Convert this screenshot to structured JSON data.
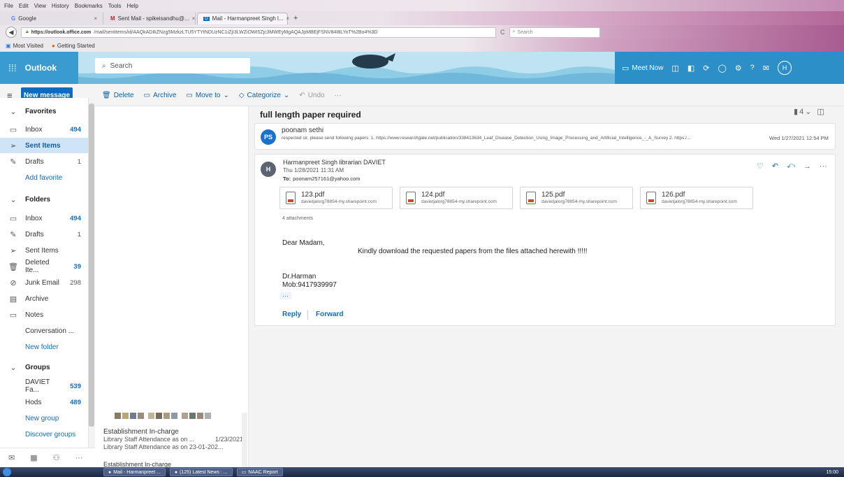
{
  "browser": {
    "menu": [
      "File",
      "Edit",
      "View",
      "History",
      "Bookmarks",
      "Tools",
      "Help"
    ],
    "tabs": [
      {
        "label": "Google"
      },
      {
        "label": "Sent Mail - spikeisandhu@..."
      },
      {
        "label": "Mail - Harmanpreet Singh l..."
      }
    ],
    "url_host": "https://outlook.office.com",
    "url_path": "/mail/sentitems/id/AAQkADIkZNzg5MzkzLTU5YTYtNDUzNC1iZjI3LWZiOWI5Zjc3MWEyMgAQAJpMBEjFSNV84I8LYoT%2Bo4%3D",
    "search_placeholder": "Search",
    "bookmarks": [
      "Most Visited",
      "Getting Started"
    ]
  },
  "outlook": {
    "brand": "Outlook",
    "search_placeholder": "Search",
    "meet_now": "Meet Now",
    "avatar_initial": "H"
  },
  "toolbar": {
    "new_message": "New message",
    "delete": "Delete",
    "archive": "Archive",
    "move_to": "Move to",
    "categorize": "Categorize",
    "undo": "Undo",
    "more": "···"
  },
  "sidebar": {
    "favorites": "Favorites",
    "fav_inbox": "Inbox",
    "fav_inbox_count": "494",
    "fav_sent": "Sent Items",
    "fav_drafts": "Drafts",
    "fav_drafts_count": "1",
    "add_favorite": "Add favorite",
    "folders": "Folders",
    "inbox": "Inbox",
    "inbox_count": "494",
    "drafts": "Drafts",
    "drafts_count": "1",
    "sent": "Sent Items",
    "deleted": "Deleted Ite...",
    "deleted_count": "39",
    "junk": "Junk Email",
    "junk_count": "298",
    "archive": "Archive",
    "notes": "Notes",
    "conversation": "Conversation ...",
    "new_folder": "New folder",
    "groups": "Groups",
    "group1": "DAVIET Fa...",
    "group1_count": "539",
    "group2": "Hods",
    "group2_count": "489",
    "new_group": "New group",
    "discover_groups": "Discover groups"
  },
  "message_list": {
    "item1_sender": "Establishment In-charge",
    "item1_preview": "Library Staff Attendance as on ...",
    "item1_date": "1/23/2021",
    "item1_preview2": "Library Staff Attendance as on 23-01-202...",
    "item2_sender": "Establishment In-charge"
  },
  "reading": {
    "subject": "full length paper required",
    "thread_count": "4",
    "first": {
      "initials": "PS",
      "sender": "poonam sethi",
      "preview": "respected sir, please send following papers: 1. https://www.researchgate.net/publication/338413634_Leaf_Disease_Detection_Using_Image_Processing_and_Artificial_Intelligence_-_A_Survey 2. https:/...",
      "date": "Wed 1/27/2021 12:54 PM"
    },
    "second": {
      "initial": "H",
      "sender": "Harmanpreet Singh librarian DAVIET",
      "date": "Thu 1/28/2021 11:31 AM",
      "to_label": "To:",
      "to": "poonam257161@yahoo.com",
      "attachments": [
        {
          "name": "123.pdf",
          "source": "davietjalorg78854-my.sharepoint.com"
        },
        {
          "name": "124.pdf",
          "source": "davietjalorg78854-my.sharepoint.com"
        },
        {
          "name": "125.pdf",
          "source": "davietjalorg78854-my.sharepoint.com"
        },
        {
          "name": "126.pdf",
          "source": "davietjalorg78854-my.sharepoint.com"
        }
      ],
      "attachments_count": "4 attachments",
      "greeting": "Dear Madam,",
      "body": "Kindly download the requested papers from the files attached herewith !!!!!",
      "sig_name": "Dr.Harman",
      "sig_phone": "Mob:9417939997",
      "ellipsis": "···",
      "reply": "Reply",
      "forward": "Forward"
    }
  },
  "taskbar": {
    "items": [
      "Mail - Harmanpreet ...",
      "(125) Latest News : ...",
      "NAAC Report"
    ],
    "clock": "15:00"
  }
}
